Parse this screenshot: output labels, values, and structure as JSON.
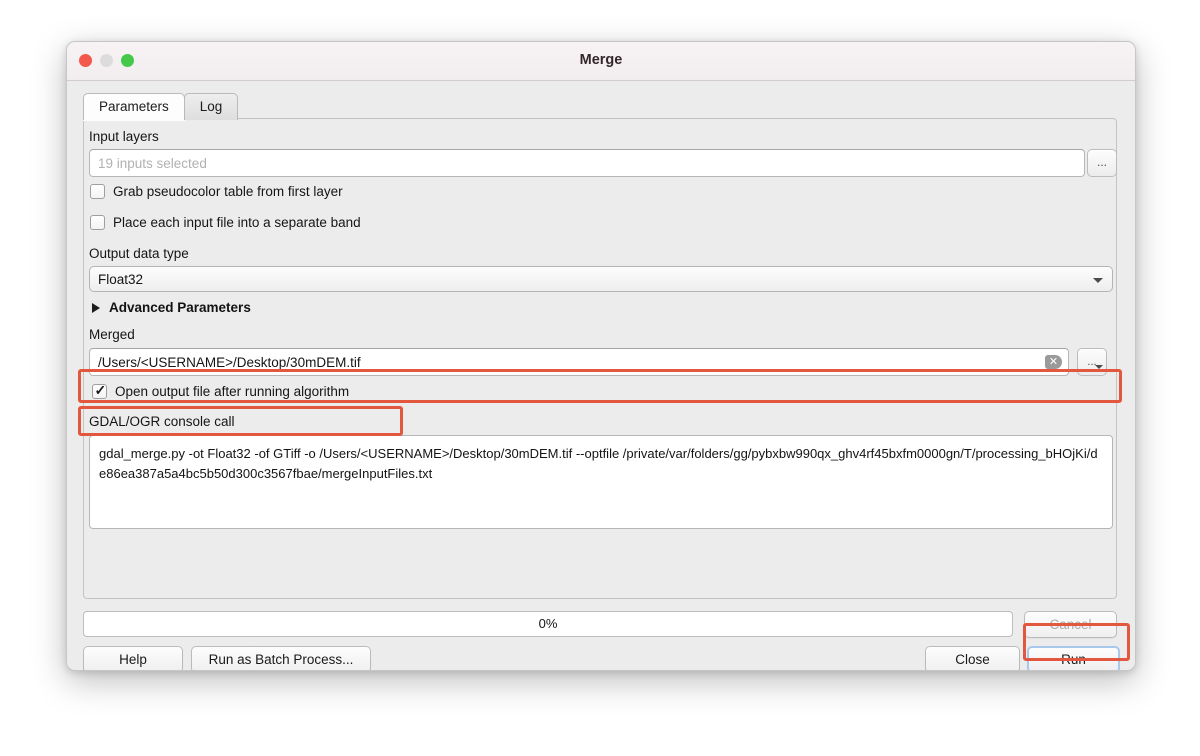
{
  "window": {
    "title": "Merge",
    "traffic_lights": [
      "close-red",
      "minimize-gray",
      "zoom-green"
    ]
  },
  "tabs": [
    {
      "label": "Parameters",
      "active": true
    },
    {
      "label": "Log",
      "active": false
    }
  ],
  "form": {
    "input_layers": {
      "label": "Input layers",
      "value": "19 inputs selected",
      "browse_label": "..."
    },
    "grab_pseudocolor": {
      "label": "Grab pseudocolor table from first layer",
      "checked": false
    },
    "separate_band": {
      "label": "Place each input file into a separate band",
      "checked": false
    },
    "output_data_type": {
      "label": "Output data type",
      "value": "Float32"
    },
    "advanced_parameters": {
      "label": "Advanced Parameters",
      "expanded": false
    },
    "merged": {
      "label": "Merged",
      "value": "/Users/<USERNAME>/Desktop/30mDEM.tif",
      "clear_icon": "clear-x-icon",
      "browse_label": "..."
    },
    "open_output": {
      "label": "Open output file after running algorithm",
      "checked": true
    },
    "console_call": {
      "label": "GDAL/OGR console call",
      "value": "gdal_merge.py -ot Float32 -of GTiff -o /Users/<USERNAME>/Desktop/30mDEM.tif --optfile /private/var/folders/gg/pybxbw990qx_ghv4rf45bxfm0000gn/T/processing_bHOjKi/de86ea387a5a4bc5b50d300c3567fbae/mergeInputFiles.txt"
    }
  },
  "footer": {
    "progress": "0%",
    "help_label": "Help",
    "batch_label": "Run as Batch Process...",
    "cancel_label": "Cancel",
    "close_label": "Close",
    "run_label": "Run"
  },
  "colors": {
    "annotation_red": "#e4573f",
    "focus_blue": "#a8c8ec",
    "window_bg": "#ececec"
  }
}
